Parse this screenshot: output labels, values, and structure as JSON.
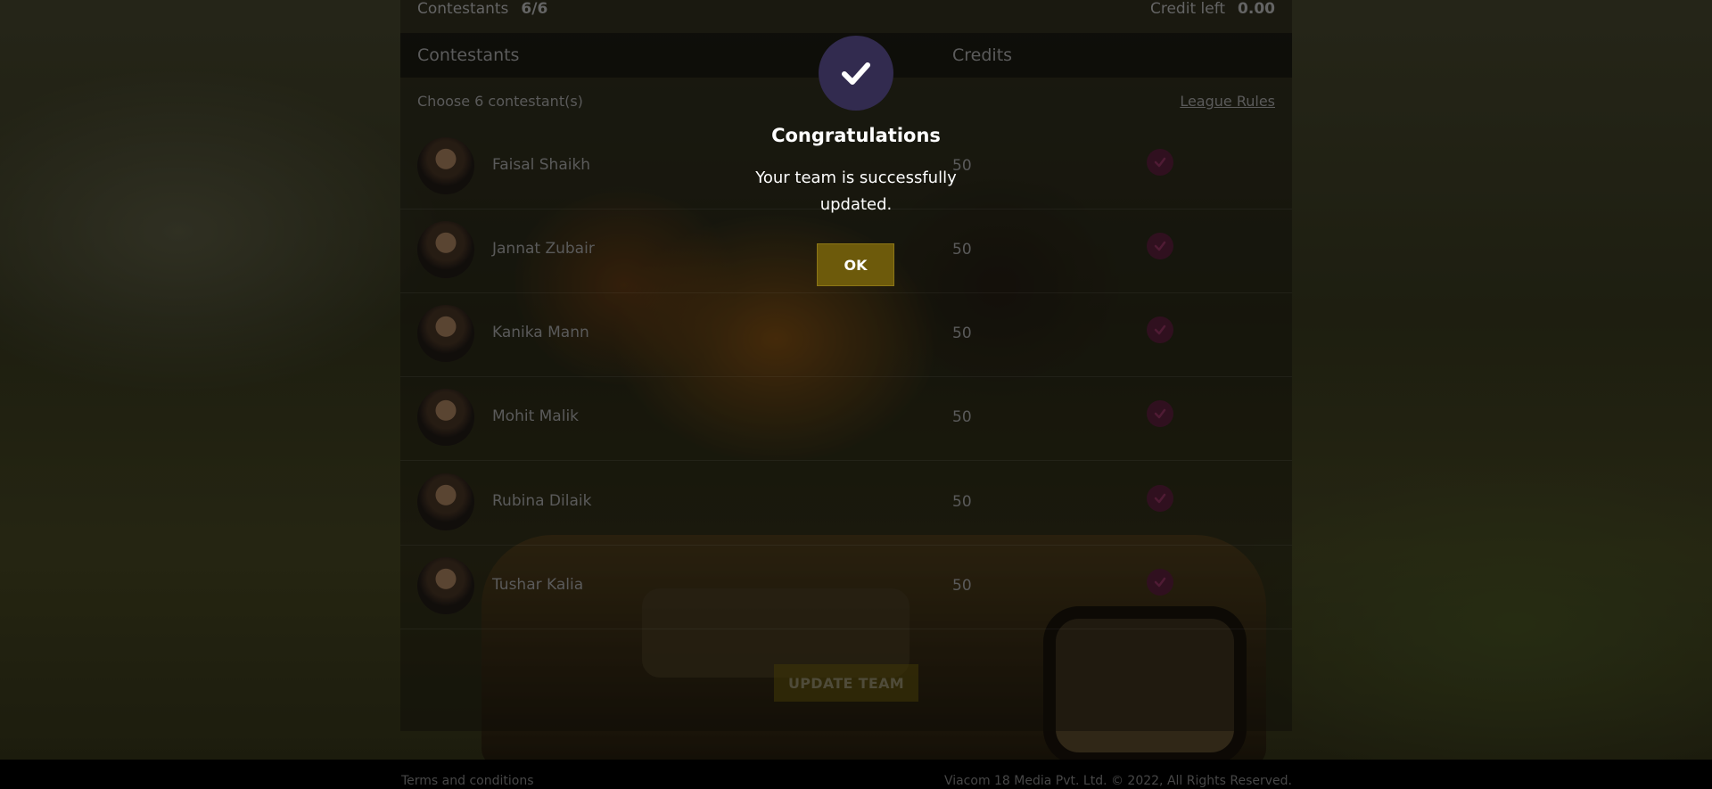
{
  "summary": {
    "contestants_label": "Contestants",
    "contestants_value": "6/6",
    "credit_label": "Credit left",
    "credit_value": "0.00"
  },
  "table": {
    "col_contestants": "Contestants",
    "col_credits": "Credits",
    "choose_text": "Choose 6 contestant(s)",
    "rules_link": "League Rules",
    "rows": [
      {
        "name": "Faisal Shaikh",
        "credits": "50",
        "selected": true
      },
      {
        "name": "Jannat Zubair",
        "credits": "50",
        "selected": true
      },
      {
        "name": "Kanika Mann",
        "credits": "50",
        "selected": true
      },
      {
        "name": "Mohit Malik",
        "credits": "50",
        "selected": true
      },
      {
        "name": "Rubina Dilaik",
        "credits": "50",
        "selected": true
      },
      {
        "name": "Tushar Kalia",
        "credits": "50",
        "selected": true
      }
    ]
  },
  "update_button": "UPDATE TEAM",
  "footer": {
    "terms": "Terms and conditions",
    "copyright": "Viacom 18 Media Pvt. Ltd. © 2022, All Rights Reserved."
  },
  "modal": {
    "icon": "checkmark-icon",
    "title": "Congratulations",
    "message": "Your team is successfully updated.",
    "ok_label": "OK"
  },
  "colors": {
    "modal_circle": "#322b4f",
    "ok_button": "#6d5a0b",
    "tick_bg": "#4a1a30"
  }
}
